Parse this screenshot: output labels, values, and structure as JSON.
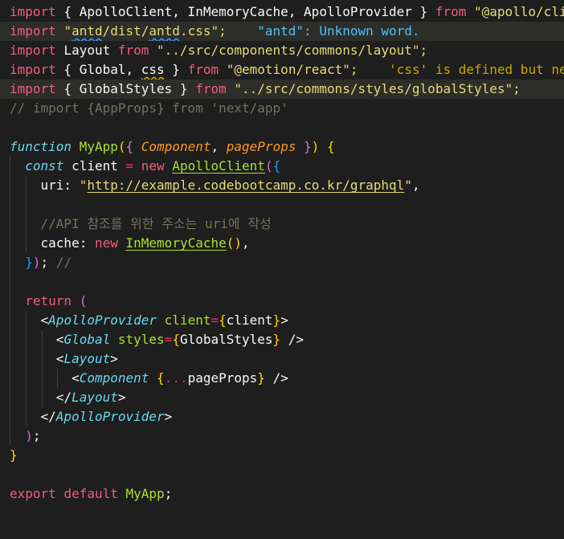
{
  "editor": {
    "lines": [
      {
        "tokens": [
          [
            "imp",
            "import"
          ],
          [
            "plain",
            " { ApolloClient, InMemoryCache, ApolloProvider } "
          ],
          [
            "imp",
            "from"
          ],
          [
            "plain",
            " "
          ],
          [
            "str",
            "\"@apollo/client\";"
          ]
        ]
      },
      {
        "tokens": [
          [
            "imp",
            "import"
          ],
          [
            "plain",
            " "
          ],
          [
            "str",
            "\""
          ],
          [
            "str squig",
            "antd"
          ],
          [
            "str",
            "/dist/"
          ],
          [
            "str squig",
            "antd"
          ],
          [
            "str",
            ".css\";"
          ],
          [
            "plain",
            "    "
          ],
          [
            "err",
            "\"antd\": Unknown word."
          ]
        ]
      },
      {
        "tokens": [
          [
            "imp",
            "import"
          ],
          [
            "plain",
            " Layout "
          ],
          [
            "imp",
            "from"
          ],
          [
            "plain",
            " "
          ],
          [
            "str",
            "\"../src/components/commons/layout\";"
          ]
        ]
      },
      {
        "tokens": [
          [
            "imp",
            "import"
          ],
          [
            "plain",
            " { Global, "
          ],
          [
            "plain squig-y",
            "css"
          ],
          [
            "plain",
            " } "
          ],
          [
            "imp",
            "from"
          ],
          [
            "plain",
            " "
          ],
          [
            "str",
            "\"@emotion/react\";"
          ],
          [
            "plain",
            "    "
          ],
          [
            "warn",
            "'css' is defined but never used."
          ]
        ]
      },
      {
        "tokens": [
          [
            "imp",
            "import"
          ],
          [
            "plain",
            " { GlobalStyles } "
          ],
          [
            "imp",
            "from"
          ],
          [
            "plain",
            " "
          ],
          [
            "str",
            "\"../src/commons/styles/globalStyles\";"
          ]
        ]
      },
      {
        "tokens": [
          [
            "cmt",
            "// import {AppProps} from 'next/app'"
          ]
        ]
      },
      {
        "tokens": []
      },
      {
        "tokens": [
          [
            "fnkw",
            "function"
          ],
          [
            "plain",
            " "
          ],
          [
            "fn",
            "MyApp"
          ],
          [
            "brk1",
            "("
          ],
          [
            "brk2",
            "{"
          ],
          [
            "plain",
            " "
          ],
          [
            "param",
            "Component"
          ],
          [
            "plain",
            ", "
          ],
          [
            "param",
            "pageProps"
          ],
          [
            "plain",
            " "
          ],
          [
            "brk2",
            "}"
          ],
          [
            "brk1",
            ")"
          ],
          [
            "plain",
            " "
          ],
          [
            "brk1",
            "{"
          ]
        ]
      },
      {
        "tokens": [
          [
            "plain",
            "  "
          ],
          [
            "fnkw",
            "const"
          ],
          [
            "plain",
            " client "
          ],
          [
            "op",
            "="
          ],
          [
            "plain",
            " "
          ],
          [
            "imp",
            "new"
          ],
          [
            "plain",
            " "
          ],
          [
            "ufn",
            "ApolloClient"
          ],
          [
            "brk2",
            "("
          ],
          [
            "brk3",
            "{"
          ]
        ]
      },
      {
        "tokens": [
          [
            "plain",
            "    uri: "
          ],
          [
            "str",
            "\""
          ],
          [
            "str url",
            "http://example.codebootcamp.co.kr/graphql"
          ],
          [
            "str",
            "\""
          ],
          [
            "plain",
            ","
          ]
        ]
      },
      {
        "tokens": []
      },
      {
        "tokens": [
          [
            "plain",
            "    "
          ],
          [
            "cmt",
            "//API 참조를 위한 주소는 uri에 작성"
          ]
        ]
      },
      {
        "tokens": [
          [
            "plain",
            "    cache: "
          ],
          [
            "imp",
            "new"
          ],
          [
            "plain",
            " "
          ],
          [
            "ufn",
            "InMemoryCache"
          ],
          [
            "brk1",
            "()"
          ],
          [
            "plain",
            ","
          ]
        ]
      },
      {
        "tokens": [
          [
            "plain",
            "  "
          ],
          [
            "brk3",
            "}"
          ],
          [
            "brk2",
            ")"
          ],
          [
            "plain",
            "; "
          ],
          [
            "cmt",
            "//"
          ]
        ]
      },
      {
        "tokens": []
      },
      {
        "tokens": [
          [
            "plain",
            "  "
          ],
          [
            "imp",
            "return"
          ],
          [
            "plain",
            " "
          ],
          [
            "brk2",
            "("
          ]
        ]
      },
      {
        "tokens": [
          [
            "plain",
            "    <"
          ],
          [
            "tag",
            "ApolloProvider"
          ],
          [
            "plain",
            " "
          ],
          [
            "attr",
            "client"
          ],
          [
            "op",
            "="
          ],
          [
            "brk1",
            "{"
          ],
          [
            "plain",
            "client"
          ],
          [
            "brk1",
            "}"
          ],
          [
            "plain",
            ">"
          ]
        ]
      },
      {
        "tokens": [
          [
            "plain",
            "      <"
          ],
          [
            "tag",
            "Global"
          ],
          [
            "plain",
            " "
          ],
          [
            "attr",
            "styles"
          ],
          [
            "op",
            "="
          ],
          [
            "brk1",
            "{"
          ],
          [
            "plain",
            "GlobalStyles"
          ],
          [
            "brk1",
            "}"
          ],
          [
            "plain",
            " />"
          ]
        ]
      },
      {
        "tokens": [
          [
            "plain",
            "      <"
          ],
          [
            "tag",
            "Layout"
          ],
          [
            "plain",
            ">"
          ]
        ]
      },
      {
        "tokens": [
          [
            "plain",
            "        <"
          ],
          [
            "tag",
            "Component"
          ],
          [
            "plain",
            " "
          ],
          [
            "brk1",
            "{"
          ],
          [
            "op",
            "..."
          ],
          [
            "plain",
            "pageProps"
          ],
          [
            "brk1",
            "}"
          ],
          [
            "plain",
            " />"
          ]
        ]
      },
      {
        "tokens": [
          [
            "plain",
            "      </"
          ],
          [
            "tag",
            "Layout"
          ],
          [
            "plain",
            ">"
          ]
        ]
      },
      {
        "tokens": [
          [
            "plain",
            "    </"
          ],
          [
            "tag",
            "ApolloProvider"
          ],
          [
            "plain",
            ">"
          ]
        ]
      },
      {
        "tokens": [
          [
            "plain",
            "  "
          ],
          [
            "brk2",
            ")"
          ],
          [
            "plain",
            ";"
          ]
        ]
      },
      {
        "tokens": [
          [
            "brk1",
            "}"
          ]
        ]
      },
      {
        "tokens": []
      },
      {
        "tokens": [
          [
            "imp",
            "export"
          ],
          [
            "plain",
            " "
          ],
          [
            "imp",
            "default"
          ],
          [
            "plain",
            " "
          ],
          [
            "fn",
            "MyApp"
          ],
          [
            "plain",
            ";"
          ]
        ]
      }
    ],
    "highlighted_lines": [
      1,
      4
    ],
    "guides": [
      {
        "line": 8,
        "level": 1
      },
      {
        "line": 9,
        "level": 1
      },
      {
        "line": 9,
        "level": 2
      },
      {
        "line": 10,
        "level": 1
      },
      {
        "line": 10,
        "level": 2
      },
      {
        "line": 11,
        "level": 1
      },
      {
        "line": 11,
        "level": 2
      },
      {
        "line": 12,
        "level": 1
      },
      {
        "line": 12,
        "level": 2
      },
      {
        "line": 13,
        "level": 1
      },
      {
        "line": 14,
        "level": 1
      },
      {
        "line": 15,
        "level": 1
      },
      {
        "line": 16,
        "level": 1
      },
      {
        "line": 16,
        "level": 2
      },
      {
        "line": 17,
        "level": 1
      },
      {
        "line": 17,
        "level": 2
      },
      {
        "line": 17,
        "level": 3
      },
      {
        "line": 18,
        "level": 1
      },
      {
        "line": 18,
        "level": 2
      },
      {
        "line": 18,
        "level": 3
      },
      {
        "line": 19,
        "level": 1
      },
      {
        "line": 19,
        "level": 2
      },
      {
        "line": 19,
        "level": 3
      },
      {
        "line": 19,
        "level": 4
      },
      {
        "line": 20,
        "level": 1
      },
      {
        "line": 20,
        "level": 2
      },
      {
        "line": 20,
        "level": 3
      },
      {
        "line": 21,
        "level": 1
      },
      {
        "line": 21,
        "level": 2
      },
      {
        "line": 22,
        "level": 1
      }
    ]
  }
}
